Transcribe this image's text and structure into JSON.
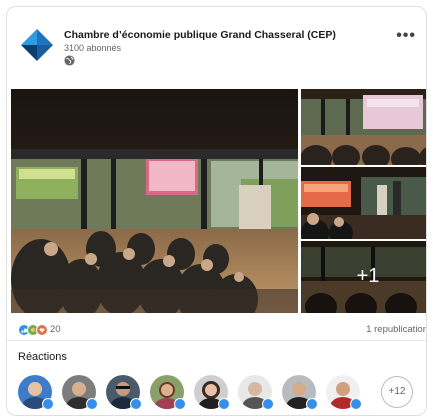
{
  "post": {
    "company_name": "Chambre d’économie publique Grand Chasseral (CEP)",
    "followers": "3100 abonnés",
    "visibility_icon": "globe-icon",
    "more_label": "•••",
    "media": {
      "extra_count": "+1"
    }
  },
  "stats": {
    "reaction_count": "20",
    "reposts": "1 republication",
    "reaction_icons": [
      "like-icon",
      "celebrate-icon",
      "support-icon"
    ]
  },
  "reactions": {
    "title": "Réactions",
    "more_count": "+12"
  },
  "colors": {
    "brand_blue": "#1e73be",
    "like_blue": "#378fe9",
    "text_secondary": "#666666"
  }
}
